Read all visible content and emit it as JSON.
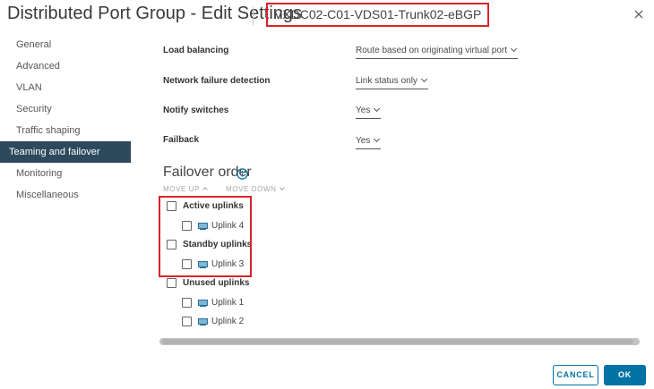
{
  "dialog": {
    "title": "Distributed Port Group - Edit Settings",
    "object_name": "VXDC02-C01-VDS01-Trunk02-eBGP"
  },
  "nav": {
    "items": [
      {
        "label": "General"
      },
      {
        "label": "Advanced"
      },
      {
        "label": "VLAN"
      },
      {
        "label": "Security"
      },
      {
        "label": "Traffic shaping"
      },
      {
        "label": "Teaming and failover"
      },
      {
        "label": "Monitoring"
      },
      {
        "label": "Miscellaneous"
      }
    ],
    "active": "Teaming and failover"
  },
  "settings": {
    "load_balancing": {
      "label": "Load balancing",
      "value": "Route based on originating virtual port"
    },
    "network_failure_detection": {
      "label": "Network failure detection",
      "value": "Link status only"
    },
    "notify_switches": {
      "label": "Notify switches",
      "value": "Yes"
    },
    "failback": {
      "label": "Failback",
      "value": "Yes"
    }
  },
  "failover": {
    "heading": "Failover order",
    "move_up": "MOVE UP",
    "move_down": "MOVE DOWN",
    "active_uplinks": {
      "label": "Active uplinks",
      "items": [
        "Uplink 4"
      ]
    },
    "standby_uplinks": {
      "label": "Standby uplinks",
      "items": [
        "Uplink 3"
      ]
    },
    "unused_uplinks": {
      "label": "Unused uplinks",
      "items": [
        "Uplink 1",
        "Uplink 2"
      ]
    }
  },
  "footer": {
    "cancel_label": "CANCEL",
    "ok_label": "OK"
  },
  "colors": {
    "accent": "#0072a3",
    "nav_active_bg": "#2d4a5c",
    "annotation_red": "#d9232a"
  },
  "icons": {
    "close": "close-icon",
    "info": "info-icon",
    "uplink": "network-adapter-icon"
  }
}
